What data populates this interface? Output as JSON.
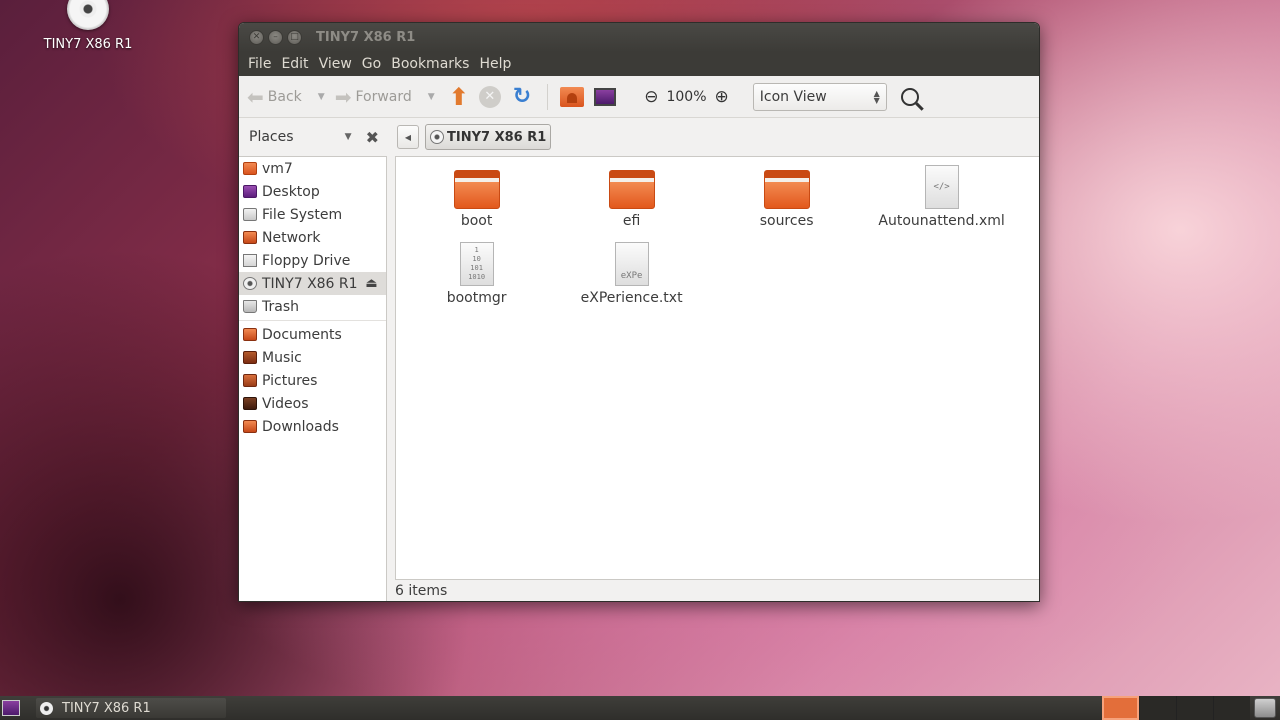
{
  "desktop": {
    "icon_label": "TINY7 X86 R1"
  },
  "window": {
    "title": "TINY7 X86 R1",
    "menu": [
      "File",
      "Edit",
      "View",
      "Go",
      "Bookmarks",
      "Help"
    ],
    "toolbar": {
      "back_label": "Back",
      "forward_label": "Forward",
      "zoom_level": "100%",
      "view_mode": "Icon View"
    },
    "sidebar_header": "Places",
    "breadcrumb": "TINY7 X86 R1",
    "places": [
      {
        "label": "vm7",
        "icon": "home-folder-icon"
      },
      {
        "label": "Desktop",
        "icon": "desktop-icon"
      },
      {
        "label": "File System",
        "icon": "hard-disk-icon"
      },
      {
        "label": "Network",
        "icon": "network-icon"
      },
      {
        "label": "Floppy Drive",
        "icon": "floppy-icon"
      },
      {
        "label": "TINY7 X86 R1",
        "icon": "cd-disc-icon"
      },
      {
        "label": "Trash",
        "icon": "trash-icon"
      }
    ],
    "bookmarks": [
      {
        "label": "Documents",
        "icon": "documents-folder-icon"
      },
      {
        "label": "Music",
        "icon": "music-folder-icon"
      },
      {
        "label": "Pictures",
        "icon": "pictures-folder-icon"
      },
      {
        "label": "Videos",
        "icon": "videos-folder-icon"
      },
      {
        "label": "Downloads",
        "icon": "downloads-folder-icon"
      }
    ],
    "files": [
      {
        "name": "boot",
        "type": "folder"
      },
      {
        "name": "efi",
        "type": "folder"
      },
      {
        "name": "sources",
        "type": "folder"
      },
      {
        "name": "Autounattend.xml",
        "type": "xml",
        "glyph": "</>"
      },
      {
        "name": "bootmgr",
        "type": "binary",
        "glyph": "1\n10\n101\n1010"
      },
      {
        "name": "eXPerience.txt",
        "type": "text",
        "glyph": "eXPe"
      }
    ],
    "status": "6 items"
  },
  "panel": {
    "task_label": "TINY7 X86 R1"
  },
  "colors": {
    "accent": "#e2581c",
    "titlebar": "#3c3b37",
    "selection": "#dedcd9"
  }
}
